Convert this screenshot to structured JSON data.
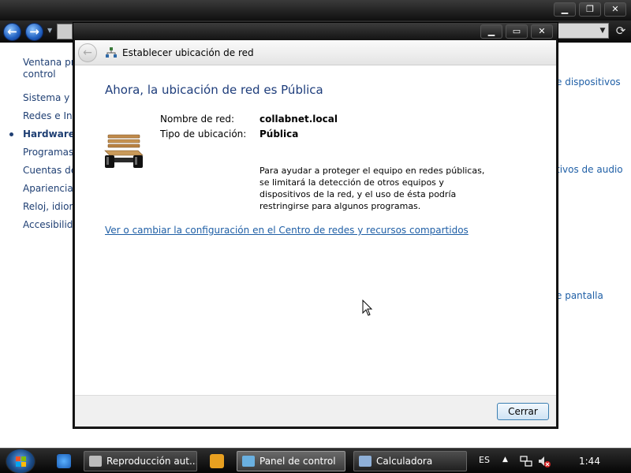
{
  "background_window": {
    "sidebar": {
      "items": [
        {
          "label": "Ventana principal del panel de control",
          "line1": "Ventana prir",
          "line2": "control"
        },
        {
          "label": "Sistema y se"
        },
        {
          "label": "Redes e Inte"
        },
        {
          "label": "Hardware y",
          "current": true
        },
        {
          "label": "Programas"
        },
        {
          "label": "Cuentas de"
        },
        {
          "label": "Apariencia"
        },
        {
          "label": "Reloj, idiom"
        },
        {
          "label": "Accesibilida"
        }
      ]
    },
    "right_links": [
      {
        "label": "e dispositivos"
      },
      {
        "label": "tivos de audio"
      },
      {
        "label": "e pantalla"
      }
    ],
    "caption": {
      "minimize": "▁",
      "maximize": "❐",
      "close": "✕"
    }
  },
  "dialog": {
    "title": "Establecer ubicación de red",
    "heading": "Ahora, la ubicación de red es Pública",
    "network_name_label": "Nombre de red:",
    "network_name_value": "collabnet.local",
    "location_type_label": "Tipo de ubicación:",
    "location_type_value": "Pública",
    "description": "Para ayudar a proteger el equipo en redes públicas, se limitará la detección de otros equipos y dispositivos de la red, y el uso de ésta podría restringirse para algunos programas.",
    "settings_link": "Ver o cambiar la configuración en el Centro de redes y recursos compartidos",
    "close_button": "Cerrar",
    "caption": {
      "minimize": "▁",
      "maximize": "▭",
      "close": "✕"
    }
  },
  "taskbar": {
    "tasks": [
      {
        "label": "Reproducción aut...",
        "active": false
      },
      {
        "label": "Panel de control",
        "active": true
      },
      {
        "label": "Calculadora",
        "active": false
      }
    ],
    "language": "ES",
    "clock": "1:44"
  },
  "colors": {
    "link": "#1f5fa6",
    "heading": "#1e3d7b",
    "button_border": "#3c7fb1"
  }
}
